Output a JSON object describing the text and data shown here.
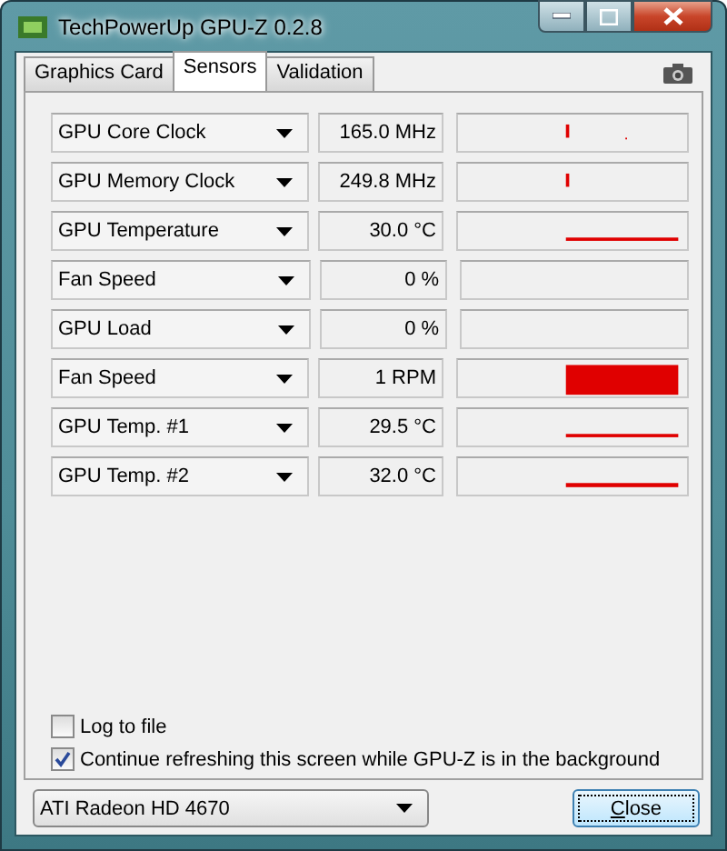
{
  "window": {
    "title": "TechPowerUp GPU-Z 0.2.8"
  },
  "tabs": [
    {
      "label": "Graphics Card",
      "selected": false
    },
    {
      "label": "Sensors",
      "selected": true
    },
    {
      "label": "Validation",
      "selected": false
    }
  ],
  "sensors": [
    {
      "name": "GPU Core Clock",
      "reading": "165.0 MHz",
      "kind": "spike"
    },
    {
      "name": "GPU Memory Clock",
      "reading": "249.8 MHz",
      "kind": "tick"
    },
    {
      "name": "GPU Temperature",
      "reading": "30.0 °C",
      "kind": "line"
    },
    {
      "name": "Fan Speed",
      "reading": "0 %",
      "kind": "empty"
    },
    {
      "name": "GPU Load",
      "reading": "0 %",
      "kind": "empty"
    },
    {
      "name": "Fan Speed",
      "reading": "1 RPM",
      "kind": "block"
    },
    {
      "name": "GPU Temp. #1",
      "reading": "29.5 °C",
      "kind": "line"
    },
    {
      "name": "GPU Temp. #2",
      "reading": "32.0 °C",
      "kind": "thick"
    }
  ],
  "options": [
    {
      "label": "Log to file",
      "checked": false
    },
    {
      "label": "Continue refreshing this screen while GPU-Z is in the background",
      "checked": true
    }
  ],
  "device": {
    "value": "ATI Radeon HD 4670"
  },
  "buttons": [
    {
      "label": "Close"
    }
  ]
}
